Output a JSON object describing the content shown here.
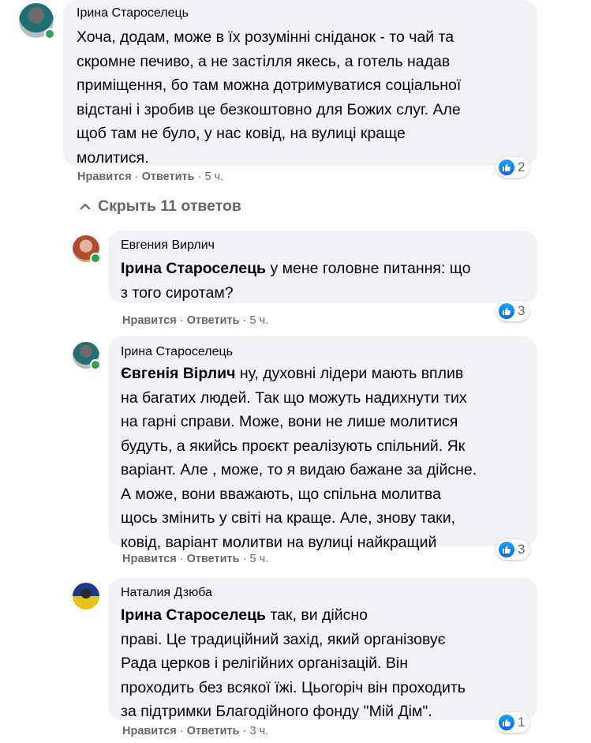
{
  "comments": [
    {
      "author": "Ірина Староселець",
      "mention": "",
      "lines": [
        "Хоча, додам, може в їх розумінні сніданок - то чай та",
        "скромне печиво, а не застілля якесь, а готель надав",
        "приміщення, бо там можна дотримуватися соціальної",
        "відстані і зробив це безкоштовно для Божих слуг. Але",
        "щоб там не було, у нас ковід, на вулиці краще",
        "молитися."
      ],
      "like_label": "Нравится",
      "sep": "·",
      "reply_label": "Ответить",
      "time": "5 ч.",
      "reactions": "2"
    },
    {
      "author": "Евгения Вирлич",
      "mention": "Ірина Староселець",
      "lines": [
        " у мене головне питання: що",
        "з того сиротам?"
      ],
      "like_label": "Нравится",
      "sep": "·",
      "reply_label": "Ответить",
      "time": "5 ч.",
      "reactions": "3"
    },
    {
      "author": "Ірина Староселець",
      "mention": "Євгенія Вірлич",
      "lines": [
        " ну, духовні лідери мають вплив",
        "на багатих людей. Так що можуть надихнути тих",
        "на гарні справи. Може, вони не лише молитися",
        "будуть, а якийсь проєкт реалізують спільний. Як",
        "варіант. Але , може, то я видаю бажане за дійсне.",
        "А може, вони вважають, що спільна молитва",
        "щось змінить у світі на краще. Але, знову таки,",
        "ковід, варіант молитви на вулиці найкращий"
      ],
      "like_label": "Нравится",
      "sep": "·",
      "reply_label": "Ответить",
      "time": "5 ч.",
      "reactions": "3"
    },
    {
      "author": "Наталия Дзюба",
      "mention": "Ірина Староселець",
      "lines": [
        " так, ви дійсно",
        "праві. Це традиційний захід, який організовує",
        "Рада церков і релігійних організацій. Він",
        "проходить без всякої їжі. Цьогоріч він проходить",
        "за підтримки Благодійного фонду \"Мій Дім\"."
      ],
      "like_label": "Нравится",
      "sep": "·",
      "reply_label": "Ответить",
      "time": "3 ч.",
      "reactions": "1"
    }
  ],
  "replies_toggle": {
    "icon": "chevron-up-icon",
    "label": "Скрыть 11 ответов"
  },
  "colors": {
    "bubble": "#f0f2f5",
    "muted_text": "#65676b",
    "online": "#31a24c",
    "like_blue": "#1877f2"
  }
}
